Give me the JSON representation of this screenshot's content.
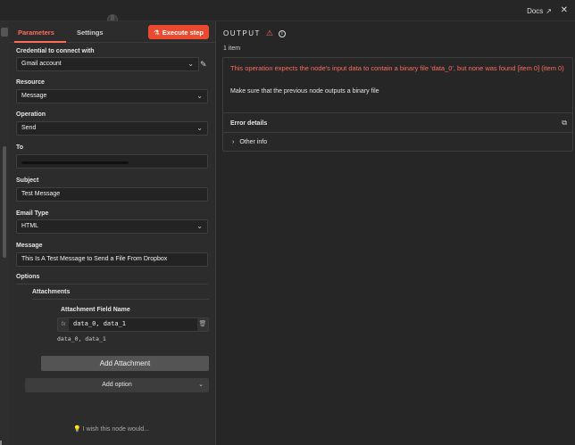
{
  "topbar": {
    "docs_label": "Docs",
    "close_icon": "close-icon",
    "external_icon": "external-link-icon"
  },
  "tabs": {
    "parameters": "Parameters",
    "settings": "Settings"
  },
  "toolbar": {
    "execute_label": "Execute step",
    "execute_icon": "flask-icon",
    "accent": "#ea4b30"
  },
  "fields": {
    "credential": {
      "label": "Credential to connect with",
      "value": "Gmail account"
    },
    "resource": {
      "label": "Resource",
      "value": "Message"
    },
    "operation": {
      "label": "Operation",
      "value": "Send"
    },
    "to": {
      "label": "To"
    },
    "subject": {
      "label": "Subject",
      "value": "Test Message"
    },
    "email_type": {
      "label": "Email Type",
      "value": "HTML"
    },
    "message": {
      "label": "Message",
      "value": "This Is A Test Message to Send a File From Dropbox"
    }
  },
  "options": {
    "label": "Options",
    "attachments_label": "Attachments",
    "attachment_field_label": "Attachment Field Name",
    "attachment_field_value": "data_0, data_1",
    "attachment_hint": "data_0, data_1",
    "fx_label": "fx",
    "add_attachment_label": "Add Attachment",
    "add_option_label": "Add option"
  },
  "footer": {
    "wish_label": "I wish this node would..."
  },
  "output": {
    "title": "OUTPUT",
    "items_count": "1 item",
    "error_message": "This operation expects the node's input data to contain a binary file 'data_0', but none was found [item 0] (item 0)",
    "error_hint": "Make sure that the previous node outputs a binary file",
    "error_details_label": "Error details",
    "other_info_label": "Other info",
    "error_color": "#ff6d5a"
  }
}
